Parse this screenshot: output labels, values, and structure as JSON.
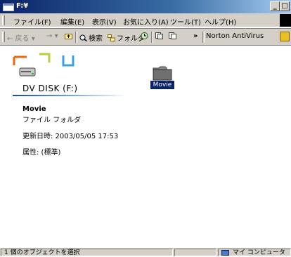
{
  "window": {
    "title": "F:¥"
  },
  "window_buttons": {
    "minimize": "_",
    "maximize": "□"
  },
  "menu": [
    "ファイル(F)",
    "編集(E)",
    "表示(V)",
    "お気に入り(A)",
    "ツール(T)",
    "ヘルプ(H)"
  ],
  "toolbar": {
    "back": "← 戻る",
    "forward": "→",
    "search": "検索",
    "folders": "フォルダ",
    "overflow": "»",
    "norton": "Norton AntiVirus"
  },
  "drive": {
    "name": "DV DISK (F:)"
  },
  "details": {
    "name": "Movie",
    "type": "ファイル フォルダ",
    "modified": "更新日時: 2003/05/05 17:53",
    "attributes": "属性: (標準)"
  },
  "items": [
    {
      "label": "Movie",
      "icon": "folder-icon"
    }
  ],
  "status": {
    "selection": "1 個のオブジェクトを選択",
    "location": "マイ コンピュータ"
  },
  "colors": {
    "title_gradient_start": "#0a246a",
    "selection": "#0a246a",
    "face": "#d4d0c8"
  }
}
